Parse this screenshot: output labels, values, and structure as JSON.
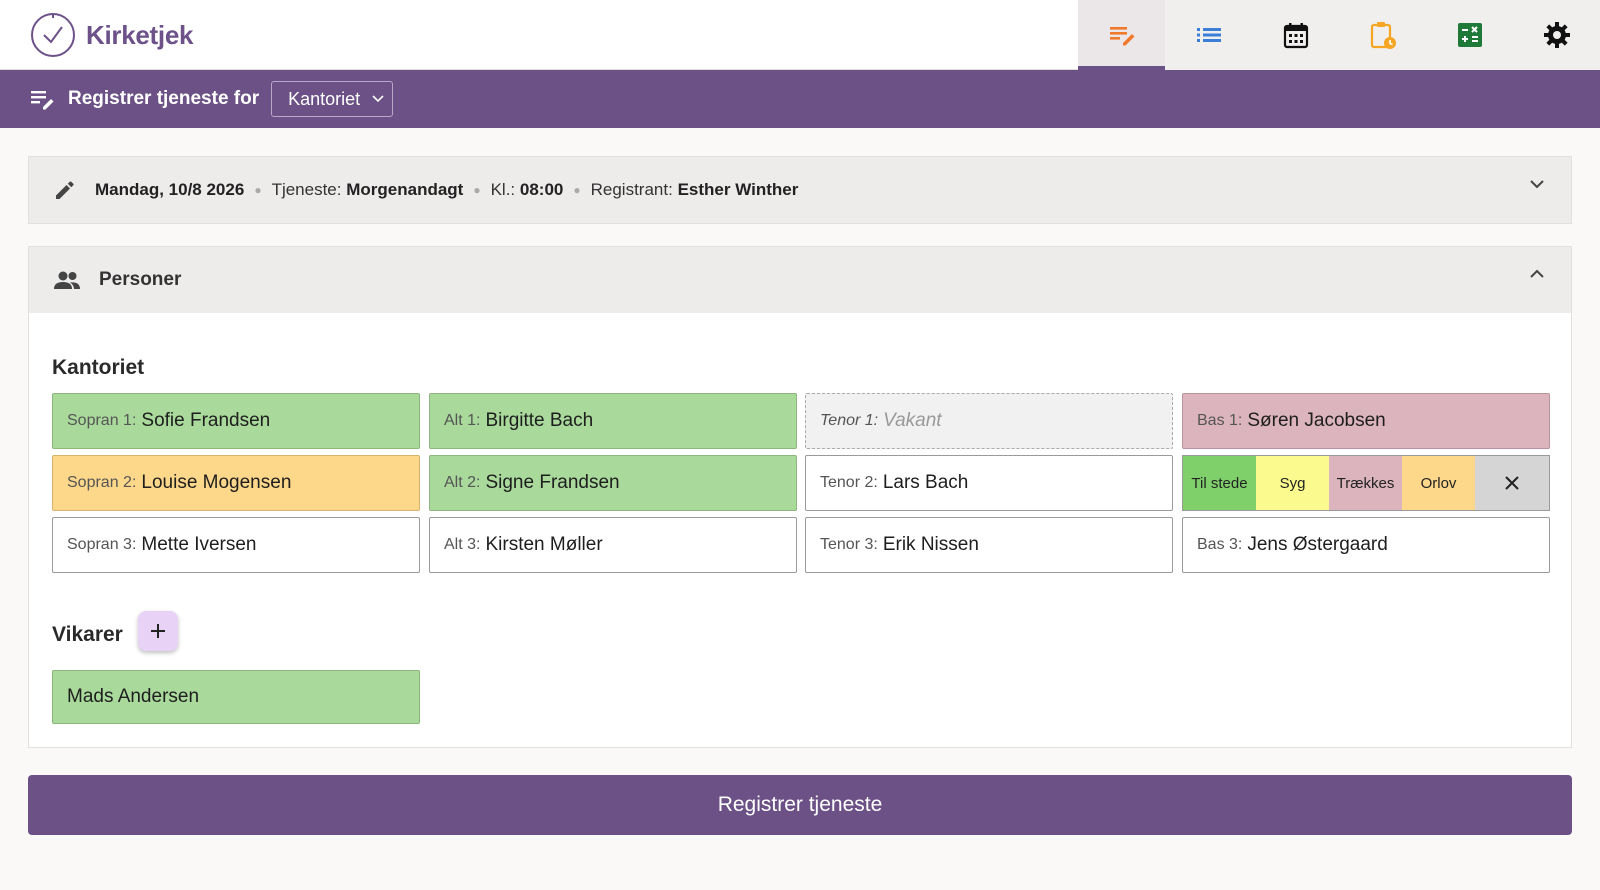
{
  "app": {
    "name": "Kirketjek"
  },
  "nav": {
    "tabs": [
      {
        "name": "register-icon",
        "active": true
      },
      {
        "name": "list-icon"
      },
      {
        "name": "calendar-icon"
      },
      {
        "name": "clipboard-clock-icon"
      },
      {
        "name": "calculator-icon"
      },
      {
        "name": "gear-icon"
      }
    ]
  },
  "subbar": {
    "title": "Registrer tjeneste for",
    "select_value": "Kantoriet"
  },
  "service": {
    "date": "Mandag, 10/8 2026",
    "service_label": "Tjeneste:",
    "service_value": "Morgenandagt",
    "time_label": "Kl.:",
    "time_value": "08:00",
    "registrant_label": "Registrant:",
    "registrant_value": "Esther Winther"
  },
  "persons": {
    "title": "Personer",
    "group_title": "Kantoriet",
    "cells": {
      "sopran1": {
        "role": "Sopran 1:",
        "name": "Sofie Frandsen",
        "status": "green"
      },
      "sopran2": {
        "role": "Sopran 2:",
        "name": "Louise Mogensen",
        "status": "orange"
      },
      "sopran3": {
        "role": "Sopran 3:",
        "name": "Mette Iversen",
        "status": "none"
      },
      "alt1": {
        "role": "Alt 1:",
        "name": "Birgitte Bach",
        "status": "green"
      },
      "alt2": {
        "role": "Alt 2:",
        "name": "Signe Frandsen",
        "status": "green"
      },
      "alt3": {
        "role": "Alt 3:",
        "name": "Kirsten Møller",
        "status": "none"
      },
      "tenor1": {
        "role": "Tenor 1:",
        "name": "Vakant",
        "status": "vacant"
      },
      "tenor2": {
        "role": "Tenor 2:",
        "name": "Lars Bach",
        "status": "none"
      },
      "tenor3": {
        "role": "Tenor 3:",
        "name": "Erik Nissen",
        "status": "none"
      },
      "bas1": {
        "role": "Bas 1:",
        "name": "Søren Jacobsen",
        "status": "pink"
      },
      "bas3": {
        "role": "Bas 3:",
        "name": "Jens Østergaard",
        "status": "none"
      }
    },
    "status_options": {
      "present": {
        "label": "Til stede",
        "color": "#7fd06b"
      },
      "sick": {
        "label": "Syg",
        "color": "#fafa8f"
      },
      "withdrawn": {
        "label": "Trækkes",
        "color": "#dcb4bd"
      },
      "leave": {
        "label": "Orlov",
        "color": "#fdd78a"
      }
    },
    "substitutes": {
      "title": "Vikarer",
      "items": [
        {
          "name": "Mads Andersen",
          "status": "green"
        }
      ]
    }
  },
  "submit_label": "Registrer tjeneste",
  "colors": {
    "brand": "#6b5186",
    "accent_orange": "#f07a2c"
  }
}
